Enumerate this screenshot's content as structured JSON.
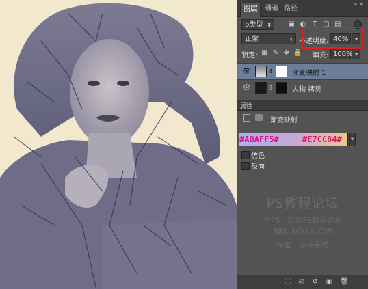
{
  "panel": {
    "tabs": [
      "图层",
      "通道",
      "路径"
    ],
    "filter": {
      "label": "ρ类型"
    },
    "blend_mode": "正常",
    "opacity": {
      "label": "不透明度:",
      "value": "40%"
    },
    "lock_label": "锁定:",
    "fill": {
      "label": "填充:",
      "value": "100%"
    },
    "layers": [
      {
        "name": "渐变映射 1",
        "selected": true
      },
      {
        "name": "人物 拷贝",
        "selected": false
      }
    ]
  },
  "properties": {
    "tab_label": "属性",
    "adjustment_title": "渐变映射",
    "gradient": {
      "left_color_text": "#ABAFF5#",
      "right_color_text": "#E7CC84#",
      "left_color": "#ABAFF5",
      "right_color": "#E7CC84"
    },
    "options": [
      {
        "label": "仿色",
        "checked": false
      },
      {
        "label": "反向",
        "checked": false
      }
    ]
  },
  "watermark": {
    "title": "PS教程论坛",
    "line1": "学PS，就到PS教程论坛",
    "line2": "BBS.16XX8.COM",
    "line3": "作者：@卡乐筠"
  },
  "icons": {
    "window": [
      "double-arrow-icon",
      "close-icon"
    ],
    "filter": [
      "image-filter-icon",
      "adjust-filter-icon",
      "text-filter-icon",
      "shape-filter-icon",
      "smart-filter-icon"
    ],
    "lock": [
      "lock-transparent-icon",
      "lock-brush-icon",
      "lock-move-icon",
      "lock-all-icon"
    ],
    "bottom": [
      "clip-to-layer-icon",
      "view-previous-icon",
      "reset-icon",
      "visibility-icon",
      "trash-icon"
    ]
  }
}
